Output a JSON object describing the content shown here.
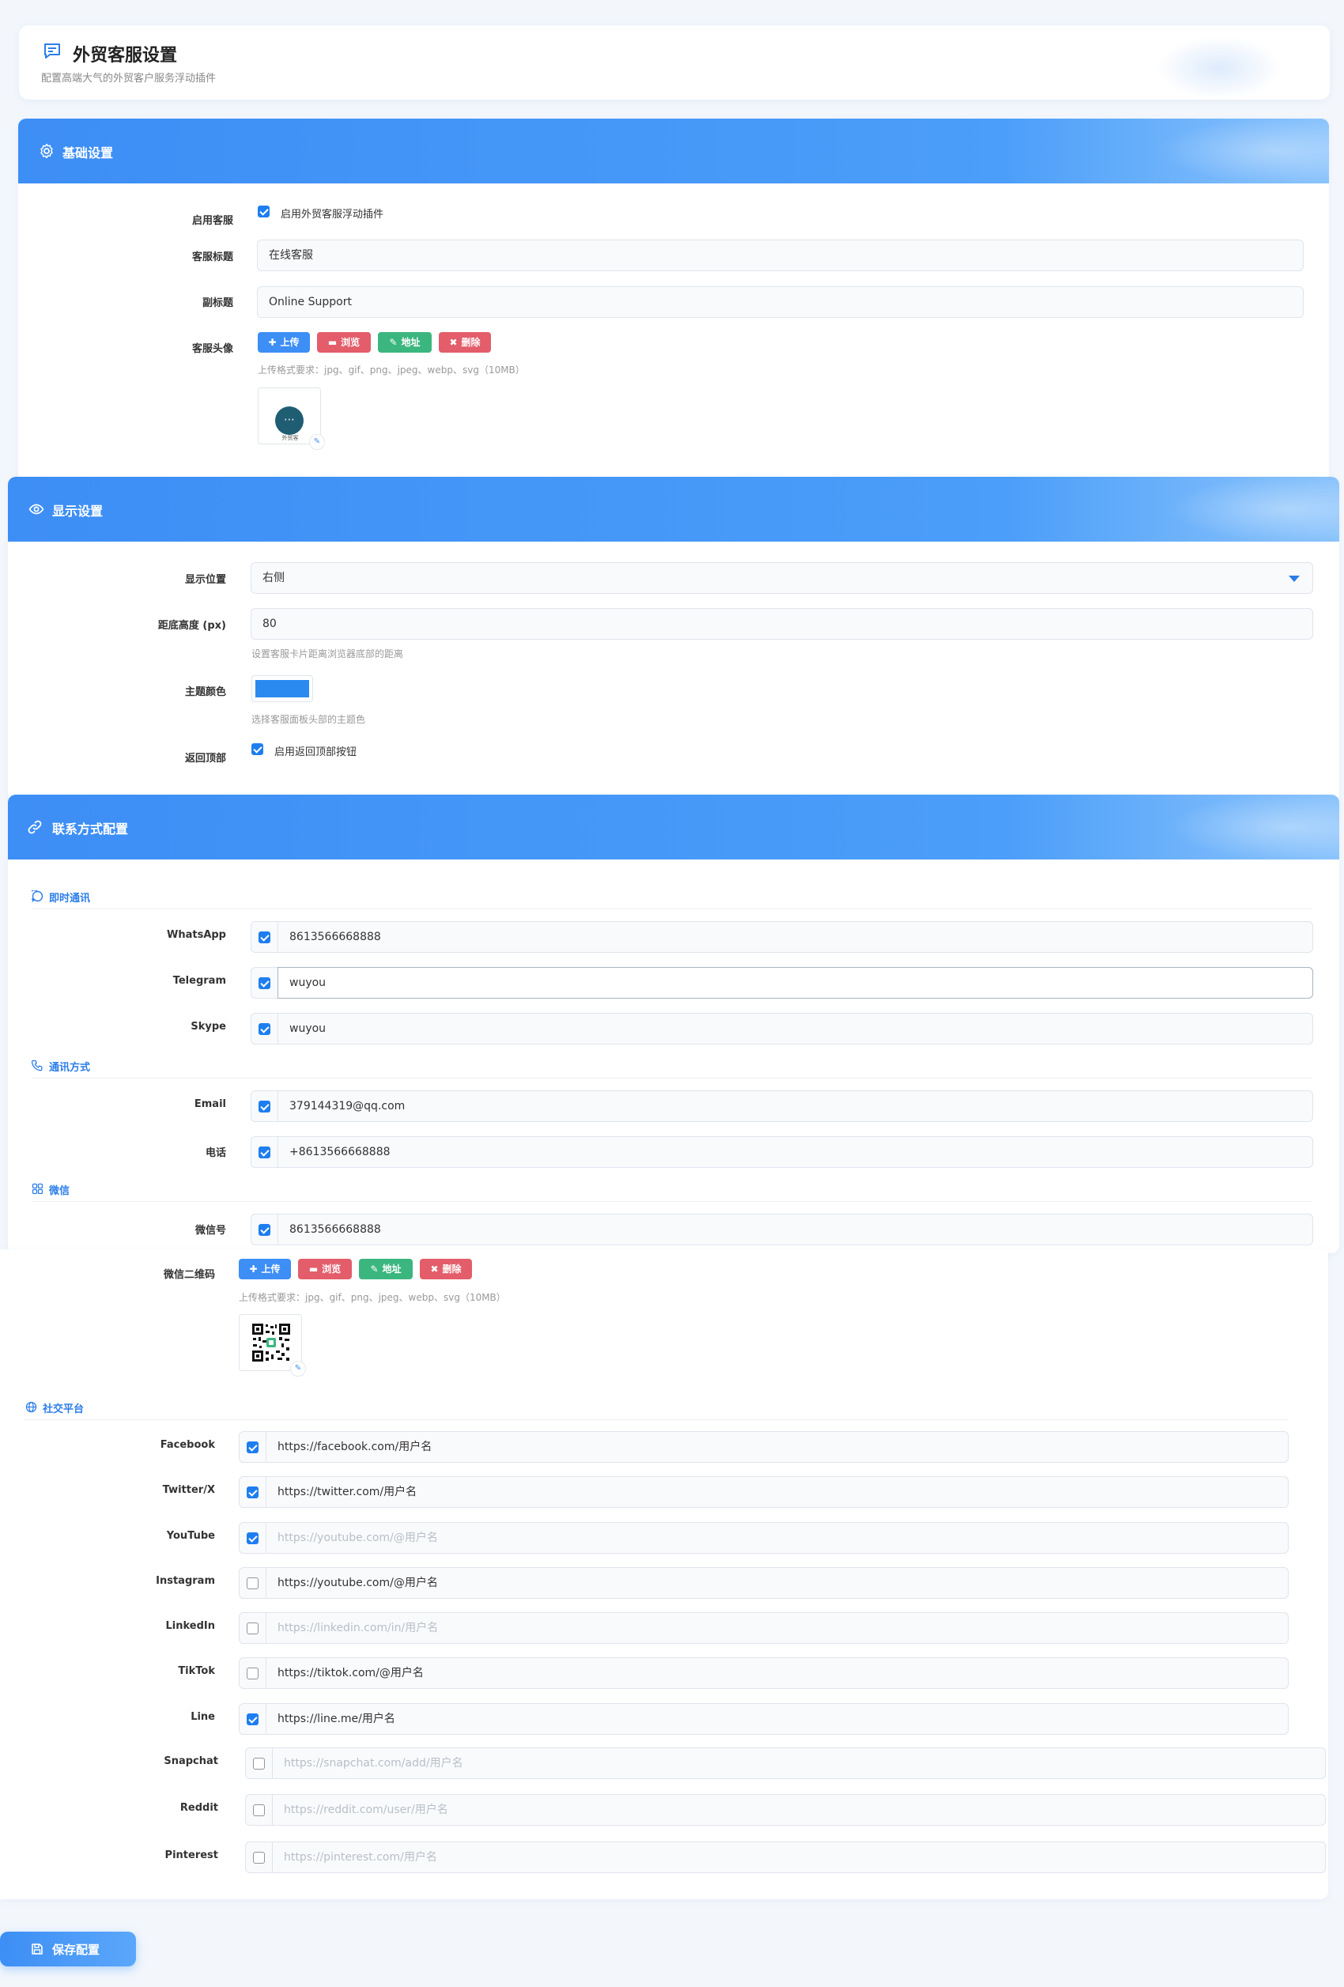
{
  "header": {
    "title": "外贸客服设置",
    "subtitle": "配置高端大气的外贸客户服务浮动插件"
  },
  "basic": {
    "title": "基础设置",
    "enable_label": "启用客服",
    "enable_checkbox_text": "启用外贸客服浮动插件",
    "enable_checked": true,
    "title_label": "客服标题",
    "title_value": "在线客服",
    "subtitle_label": "副标题",
    "subtitle_value": "Online Support",
    "avatar_label": "客服头像",
    "buttons": {
      "upload": "上传",
      "browse": "浏览",
      "address": "地址",
      "delete": "删除"
    },
    "format_hint": "上传格式要求：jpg、gif、png、jpeg、webp、svg（10MB）",
    "avatar_text": "外贸客"
  },
  "display": {
    "title": "显示设置",
    "position_label": "显示位置",
    "position_value": "右侧",
    "bottom_label": "距底高度 (px)",
    "bottom_value": "80",
    "bottom_hint": "设置客服卡片距离浏览器底部的距离",
    "color_label": "主题颜色",
    "color_value": "#2a8af0",
    "color_hint": "选择客服面板头部的主题色",
    "top_label": "返回顶部",
    "top_checkbox_text": "启用返回顶部按钮",
    "top_checked": true
  },
  "contact": {
    "title": "联系方式配置",
    "im": {
      "title": "即时通讯",
      "rows": [
        {
          "label": "WhatsApp",
          "value": "8613566668888",
          "checked": true
        },
        {
          "label": "Telegram",
          "value": "wuyou",
          "checked": true
        },
        {
          "label": "Skype",
          "value": "wuyou",
          "checked": true
        }
      ]
    },
    "comm": {
      "title": "通讯方式",
      "rows": [
        {
          "label": "Email",
          "value": "379144319@qq.com",
          "checked": true
        },
        {
          "label": "电话",
          "value": "+8613566668888",
          "checked": true
        }
      ]
    },
    "wechat": {
      "title": "微信",
      "id_label": "微信号",
      "id_value": "8613566668888",
      "id_checked": true,
      "qr_label": "微信二维码",
      "format_hint": "上传格式要求：jpg、gif、png、jpeg、webp、svg（10MB）"
    },
    "social": {
      "title": "社交平台",
      "rows": [
        {
          "label": "Facebook",
          "value": "https://facebook.com/用户名",
          "checked": true,
          "placeholder": false
        },
        {
          "label": "Twitter/X",
          "value": "https://twitter.com/用户名",
          "checked": true,
          "placeholder": false
        },
        {
          "label": "YouTube",
          "value": "https://youtube.com/@用户名",
          "checked": true,
          "placeholder": true
        },
        {
          "label": "Instagram",
          "value": "https://youtube.com/@用户名",
          "checked": false,
          "placeholder": false
        },
        {
          "label": "LinkedIn",
          "value": "https://linkedin.com/in/用户名",
          "checked": false,
          "placeholder": true
        },
        {
          "label": "TikTok",
          "value": "https://tiktok.com/@用户名",
          "checked": false,
          "placeholder": false
        },
        {
          "label": "Line",
          "value": "https://line.me/用户名",
          "checked": true,
          "placeholder": false
        },
        {
          "label": "Snapchat",
          "value": "https://snapchat.com/add/用户名",
          "checked": false,
          "placeholder": true
        },
        {
          "label": "Reddit",
          "value": "https://reddit.com/user/用户名",
          "checked": false,
          "placeholder": true
        },
        {
          "label": "Pinterest",
          "value": "https://pinterest.com/用户名",
          "checked": false,
          "placeholder": true
        }
      ]
    }
  },
  "save_label": "保存配置",
  "colors": {
    "accent": "#3d8ef5",
    "danger": "#e35d6a",
    "success": "#3bb67f"
  }
}
